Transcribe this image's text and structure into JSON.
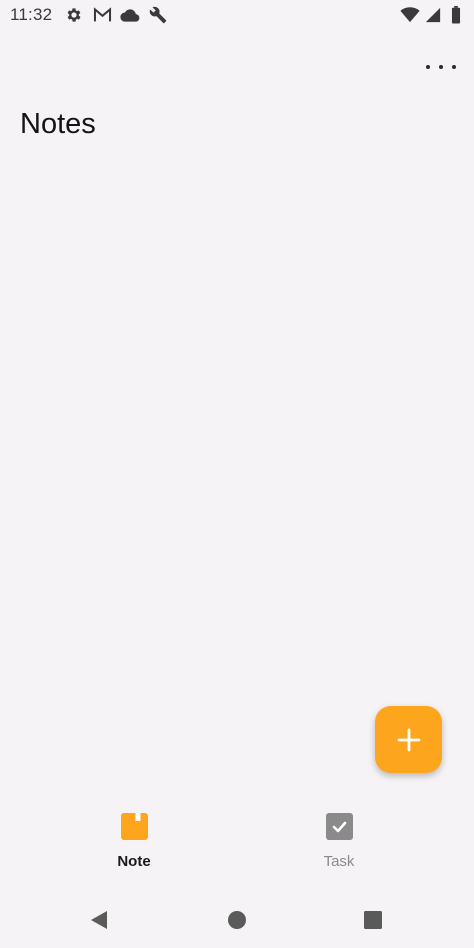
{
  "status_bar": {
    "time": "11:32",
    "left_icons": [
      "settings-icon",
      "gmail-icon",
      "cloud-icon",
      "wrench-icon"
    ],
    "right_icons": [
      "wifi-icon",
      "signal-icon",
      "battery-icon"
    ]
  },
  "app_bar": {
    "overflow_icon": "more-horizontal-icon"
  },
  "page": {
    "title": "Notes"
  },
  "fab": {
    "icon": "plus-icon",
    "color": "#fda51c"
  },
  "bottom_nav": {
    "items": [
      {
        "label": "Note",
        "icon": "note-icon",
        "selected": true,
        "color": "#fda51c"
      },
      {
        "label": "Task",
        "icon": "task-checkbox-icon",
        "selected": false,
        "color": "#8a8a8a"
      }
    ]
  },
  "system_nav": {
    "buttons": [
      "back-icon",
      "home-icon",
      "recents-icon"
    ]
  },
  "colors": {
    "background": "#f5f3f5",
    "accent": "#fda51c",
    "title_text": "#141414"
  }
}
